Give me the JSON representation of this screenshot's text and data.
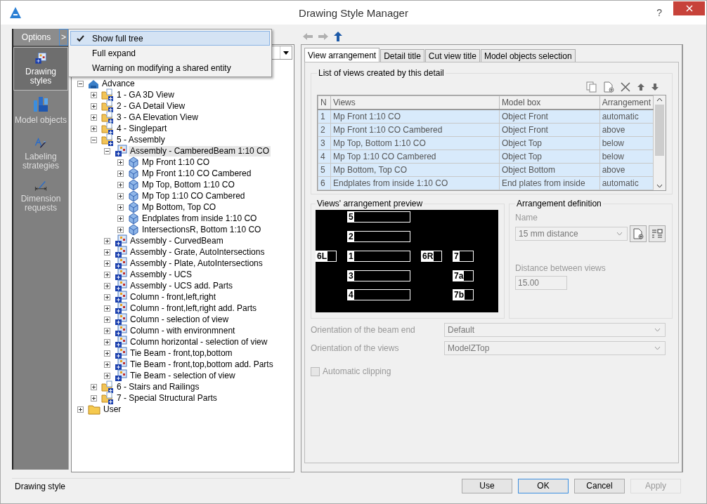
{
  "window": {
    "title": "Drawing Style Manager",
    "help": "?"
  },
  "sidebar": {
    "options_label": "Options",
    "options_arrow": ">",
    "items": [
      {
        "label": "Drawing styles",
        "kind": "styles",
        "selected": true
      },
      {
        "label": "Model objects",
        "kind": "objects",
        "selected": false
      },
      {
        "label": "Labeling strategies",
        "kind": "labeling",
        "selected": false
      },
      {
        "label": "Dimension requests",
        "kind": "dimension",
        "selected": false
      }
    ]
  },
  "options_menu": [
    {
      "label": "Show full tree",
      "checked": true,
      "selected": true
    },
    {
      "label": "Full expand",
      "checked": false,
      "selected": false
    },
    {
      "label": "Warning on modifying a shared entity",
      "checked": false,
      "selected": false
    }
  ],
  "tree": [
    {
      "label": "Advance",
      "kind": "root",
      "expanded": true,
      "selected": false,
      "children": [
        {
          "label": "1 - GA 3D View",
          "kind": "group",
          "expanded": false,
          "selected": false
        },
        {
          "label": "2 - GA Detail View",
          "kind": "group",
          "expanded": false,
          "selected": false
        },
        {
          "label": "3 - GA Elevation View",
          "kind": "group",
          "expanded": false,
          "selected": false
        },
        {
          "label": "4 - Singlepart",
          "kind": "group",
          "expanded": false,
          "selected": false
        },
        {
          "label": "5 - Assembly",
          "kind": "group",
          "expanded": true,
          "selected": false,
          "children": [
            {
              "label": "Assembly - CamberedBeam 1:10 CO",
              "kind": "style",
              "expanded": true,
              "selected": true,
              "children": [
                {
                  "label": "Mp Front 1:10 CO",
                  "kind": "view",
                  "expanded": false,
                  "selected": false
                },
                {
                  "label": "Mp Front 1:10 CO Cambered",
                  "kind": "view",
                  "expanded": false,
                  "selected": false
                },
                {
                  "label": "Mp Top, Bottom 1:10 CO",
                  "kind": "view",
                  "expanded": false,
                  "selected": false
                },
                {
                  "label": "Mp Top 1:10 CO Cambered",
                  "kind": "view",
                  "expanded": false,
                  "selected": false
                },
                {
                  "label": "Mp Bottom, Top CO",
                  "kind": "view",
                  "expanded": false,
                  "selected": false
                },
                {
                  "label": "Endplates from inside 1:10 CO",
                  "kind": "view",
                  "expanded": false,
                  "selected": false
                },
                {
                  "label": "IntersectionsR, Bottom 1:10 CO",
                  "kind": "view",
                  "expanded": false,
                  "selected": false
                }
              ]
            },
            {
              "label": "Assembly - CurvedBeam",
              "kind": "style",
              "expanded": false,
              "selected": false
            },
            {
              "label": "Assembly - Grate, AutoIntersections",
              "kind": "style",
              "expanded": false,
              "selected": false
            },
            {
              "label": "Assembly - Plate, AutoIntersections",
              "kind": "style",
              "expanded": false,
              "selected": false
            },
            {
              "label": "Assembly - UCS",
              "kind": "style",
              "expanded": false,
              "selected": false
            },
            {
              "label": "Assembly - UCS add. Parts",
              "kind": "style",
              "expanded": false,
              "selected": false
            },
            {
              "label": "Column - front,left,right",
              "kind": "style",
              "expanded": false,
              "selected": false
            },
            {
              "label": "Column - front,left,right add. Parts",
              "kind": "style",
              "expanded": false,
              "selected": false
            },
            {
              "label": "Column - selection of view",
              "kind": "style",
              "expanded": false,
              "selected": false
            },
            {
              "label": "Column - with environmnent",
              "kind": "style",
              "expanded": false,
              "selected": false
            },
            {
              "label": "Column horizontal - selection of view",
              "kind": "style",
              "expanded": false,
              "selected": false
            },
            {
              "label": "Tie Beam - front,top,bottom",
              "kind": "style",
              "expanded": false,
              "selected": false
            },
            {
              "label": "Tie Beam - front,top,bottom add. Parts",
              "kind": "style",
              "expanded": false,
              "selected": false
            },
            {
              "label": "Tie Beam - selection of view",
              "kind": "style",
              "expanded": false,
              "selected": false
            }
          ]
        },
        {
          "label": "6 - Stairs and Railings",
          "kind": "group",
          "expanded": false,
          "selected": false
        },
        {
          "label": "7 - Special Structural Parts",
          "kind": "group",
          "expanded": false,
          "selected": false
        }
      ]
    },
    {
      "label": "User",
      "kind": "folder",
      "expanded": false,
      "selected": false
    }
  ],
  "tabs": [
    {
      "label": "View arrangement",
      "selected": true
    },
    {
      "label": "Detail title",
      "selected": false
    },
    {
      "label": "Cut view title",
      "selected": false
    },
    {
      "label": "Model objects selection",
      "selected": false
    }
  ],
  "views_list": {
    "title": "List of views created by this detail",
    "columns": [
      "N",
      "Views",
      "Model box",
      "Arrangement"
    ],
    "rows": [
      {
        "cells": [
          "1",
          "Mp Front 1:10 CO",
          "Object Front",
          "automatic"
        ],
        "selected": true
      },
      {
        "cells": [
          "2",
          "Mp Front 1:10 CO Cambered",
          "Object Front",
          "above"
        ],
        "selected": true
      },
      {
        "cells": [
          "3",
          "Mp Top, Bottom 1:10 CO",
          "Object Top",
          "below"
        ],
        "selected": true
      },
      {
        "cells": [
          "4",
          "Mp Top 1:10 CO Cambered",
          "Object Top",
          "below"
        ],
        "selected": true
      },
      {
        "cells": [
          "5",
          "Mp Bottom, Top CO",
          "Object Bottom",
          "above"
        ],
        "selected": true
      },
      {
        "cells": [
          "6",
          "Endplates from inside 1:10 CO",
          "End plates from inside",
          "automatic"
        ],
        "selected": true
      }
    ]
  },
  "preview": {
    "title": "Views' arrangement preview",
    "boxes": [
      "5",
      "2",
      "6L",
      "1",
      "6R",
      "7",
      "3",
      "7a",
      "4",
      "7b"
    ]
  },
  "arrangement": {
    "title": "Arrangement definition",
    "name_label": "Name",
    "name_value": "15 mm distance",
    "distance_label": "Distance between views",
    "distance_value": "15.00",
    "disabled": true
  },
  "orientation": [
    {
      "label": "Orientation of the beam end",
      "value": "Default",
      "disabled": true
    },
    {
      "label": "Orientation of the views",
      "value": "ModelZTop",
      "disabled": true
    }
  ],
  "automatic_clipping": {
    "label": "Automatic clipping",
    "checked": false,
    "disabled": true
  },
  "status": "Drawing style",
  "buttons": [
    {
      "label": "Use",
      "disabled": false,
      "default": false
    },
    {
      "label": "OK",
      "disabled": false,
      "default": true
    },
    {
      "label": "Cancel",
      "disabled": false,
      "default": false
    },
    {
      "label": "Apply",
      "disabled": true,
      "default": false
    }
  ]
}
